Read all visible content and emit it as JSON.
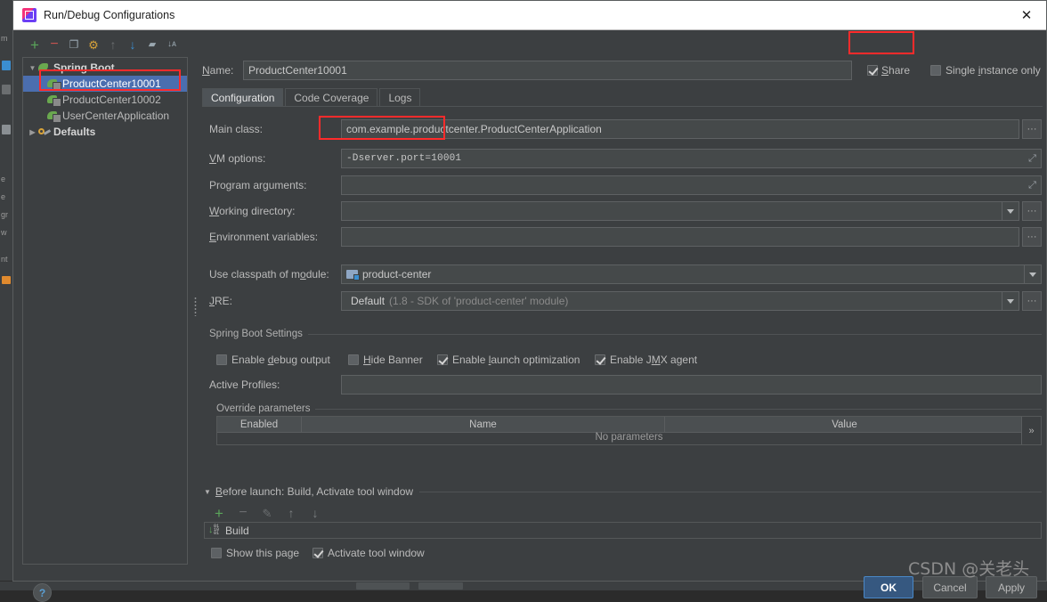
{
  "window": {
    "title": "Run/Debug Configurations",
    "app_icon": "intellij-idea-logo",
    "close_icon": "✕"
  },
  "left_panel": {
    "toolbar": [
      {
        "name": "add-configuration-button",
        "glyph": "+",
        "color": "#5aa55a"
      },
      {
        "name": "remove-configuration-button",
        "glyph": "−",
        "color": "#c75450"
      },
      {
        "name": "copy-configuration-button",
        "glyph": "❐",
        "color": "#9aa7b0"
      },
      {
        "name": "edit-templates-button",
        "glyph": "⚙",
        "color": "#d8a33a"
      },
      {
        "name": "move-up-button",
        "glyph": "↑",
        "color": "#6b6e70"
      },
      {
        "name": "move-down-button",
        "glyph": "↓",
        "color": "#3b8ed0"
      },
      {
        "name": "new-folder-button",
        "glyph": "▰",
        "color": "#9aa7b0"
      },
      {
        "name": "sort-configurations-button",
        "glyph": "↓ᴀ",
        "color": "#9aa7b0"
      }
    ],
    "tree": [
      {
        "label": "Spring Boot",
        "type": "group",
        "expanded": true,
        "icon": "spring-boot-icon",
        "indent": 0,
        "selected": false
      },
      {
        "label": "ProductCenter10001",
        "type": "item",
        "icon": "spring-boot-run-icon",
        "indent": 1,
        "selected": true
      },
      {
        "label": "ProductCenter10002",
        "type": "item",
        "icon": "spring-boot-run-icon",
        "indent": 1,
        "selected": false
      },
      {
        "label": "UserCenterApplication",
        "type": "item",
        "icon": "spring-boot-run-icon",
        "indent": 1,
        "selected": false
      },
      {
        "label": "Defaults",
        "type": "group",
        "expanded": false,
        "icon": "wrench-icon",
        "indent": 0,
        "selected": false
      }
    ]
  },
  "header": {
    "name_label": "Name:",
    "name_value": "ProductCenter10001",
    "share_label": "Share",
    "share_checked": true,
    "single_instance_label": "Single instance only",
    "single_instance_checked": false
  },
  "tabs": [
    {
      "label": "Configuration",
      "active": true
    },
    {
      "label": "Code Coverage",
      "active": false
    },
    {
      "label": "Logs",
      "active": false
    }
  ],
  "form": {
    "main_class_label": "Main class:",
    "main_class_value": "com.example.productcenter.ProductCenterApplication",
    "vm_options_label": "VM options:",
    "vm_options_value": "-Dserver.port=10001",
    "program_arguments_label": "Program arguments:",
    "program_arguments_value": "",
    "working_directory_label": "Working directory:",
    "working_directory_value": "",
    "environment_variables_label": "Environment variables:",
    "environment_variables_value": "",
    "module_label": "Use classpath of module:",
    "module_value": "product-center",
    "jre_label": "JRE:",
    "jre_value": "Default",
    "jre_value_suffix": "(1.8 - SDK of 'product-center' module)",
    "browse_glyph": "···",
    "expand_glyph": "⤢"
  },
  "spring_boot_settings": {
    "section_label": "Spring Boot Settings",
    "checkboxes": [
      {
        "label": "Enable debug output",
        "checked": false
      },
      {
        "label": "Hide Banner",
        "checked": false
      },
      {
        "label": "Enable launch optimization",
        "checked": true
      },
      {
        "label": "Enable JMX agent",
        "checked": true
      }
    ],
    "active_profiles_label": "Active Profiles:",
    "active_profiles_value": "",
    "override_parameters_label": "Override parameters",
    "table_headers": [
      "Enabled",
      "Name",
      "Value"
    ],
    "table_empty_text": "No parameters",
    "table_expand_glyph": "»"
  },
  "before_launch": {
    "header": "Before launch: Build, Activate tool window",
    "collapse_glyph": "▼",
    "toolbar": [
      {
        "name": "add-task-button",
        "glyph": "+",
        "color": "#5aa55a"
      },
      {
        "name": "remove-task-button",
        "glyph": "−",
        "color": "#6b6e70"
      },
      {
        "name": "edit-task-button",
        "glyph": "✎",
        "color": "#6b6e70"
      },
      {
        "name": "move-task-up-button",
        "glyph": "↑",
        "color": "#7c7f81"
      },
      {
        "name": "move-task-down-button",
        "glyph": "↓",
        "color": "#7c7f81"
      }
    ],
    "tasks": [
      {
        "label": "Build",
        "icon": "build-icon"
      }
    ],
    "show_page_label": "Show this page",
    "show_page_checked": false,
    "activate_window_label": "Activate tool window",
    "activate_window_checked": true
  },
  "footer": {
    "help_glyph": "?",
    "buttons": [
      {
        "label": "OK",
        "style": "primary"
      },
      {
        "label": "Cancel",
        "style": "normal"
      },
      {
        "label": "Apply",
        "style": "normal"
      }
    ]
  },
  "watermark": "CSDN @关老头",
  "annotations": [
    {
      "name": "annotation-selected-configuration"
    },
    {
      "name": "annotation-vm-options"
    },
    {
      "name": "annotation-share-checkbox"
    }
  ],
  "ide_backdrop": {
    "strip_labels": [
      "m",
      "e",
      "e",
      "gr",
      "w",
      "nt"
    ]
  },
  "colors": {
    "background": "#3c3f41",
    "field": "#45494a",
    "selection": "#4b6eaf",
    "accent_green": "#5aa55a",
    "accent_blue": "#3b8ed0",
    "annotation_red": "#ff2b2b",
    "primary_button": "#365880"
  }
}
